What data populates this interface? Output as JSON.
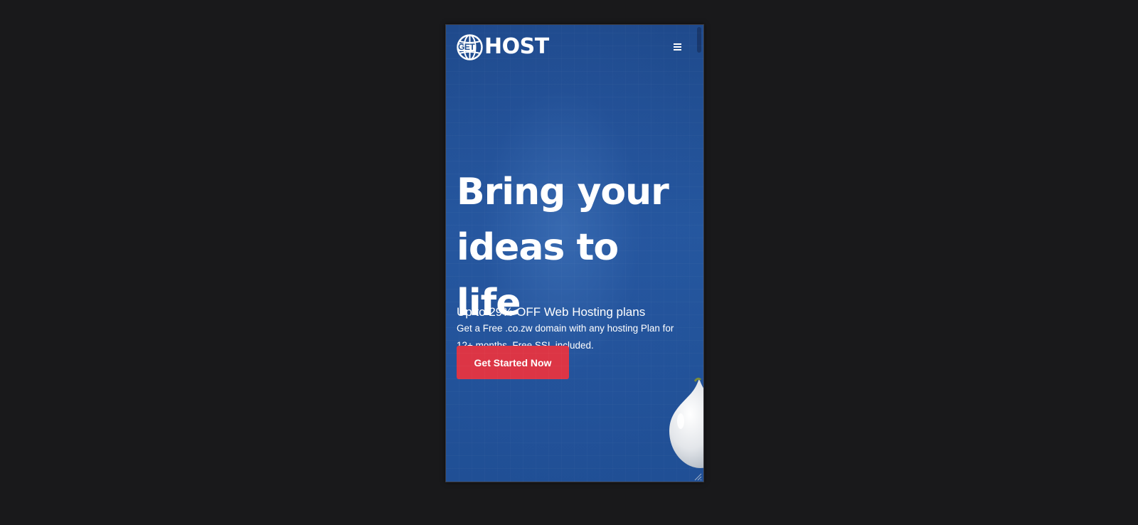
{
  "header": {
    "logo_badge": "GET",
    "logo_word": "HOST",
    "menu_icon": "hamburger-menu-icon"
  },
  "hero": {
    "headline": "Bring your ideas to life",
    "subheadline": "Up to 29% OFF Web Hosting plans",
    "description": "Get a Free .co.zw domain with any hosting Plan for 12+ months. Free SSL included.",
    "cta_label": "Get Started Now"
  },
  "colors": {
    "page_background": "#19191b",
    "hero_blue": "#1e4c8f",
    "cta_red": "#dc3545",
    "text": "#ffffff"
  }
}
